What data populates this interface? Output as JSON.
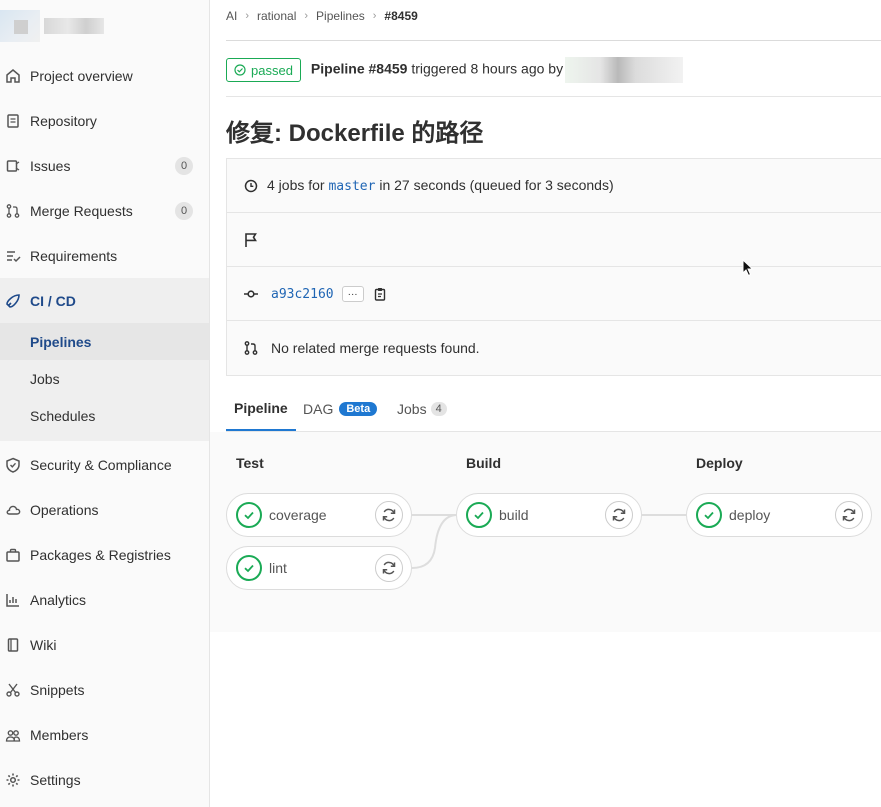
{
  "sidebar": {
    "items": [
      {
        "label": "Project overview"
      },
      {
        "label": "Repository"
      },
      {
        "label": "Issues",
        "count": "0"
      },
      {
        "label": "Merge Requests",
        "count": "0"
      },
      {
        "label": "Requirements"
      },
      {
        "label": "CI / CD"
      },
      {
        "label": "Security & Compliance"
      },
      {
        "label": "Operations"
      },
      {
        "label": "Packages & Registries"
      },
      {
        "label": "Analytics"
      },
      {
        "label": "Wiki"
      },
      {
        "label": "Snippets"
      },
      {
        "label": "Members"
      },
      {
        "label": "Settings"
      }
    ],
    "cicd_sub": [
      {
        "label": "Pipelines"
      },
      {
        "label": "Jobs"
      },
      {
        "label": "Schedules"
      }
    ]
  },
  "breadcrumb": [
    "AI",
    "rational",
    "Pipelines",
    "#8459"
  ],
  "pipeline": {
    "status": "passed",
    "title_bold": "Pipeline #8459",
    "title_rest": " triggered 8 hours ago by"
  },
  "commit_title": "修复: Dockerfile 的路径",
  "info": {
    "jobs_prefix": "4 jobs for ",
    "branch": "master",
    "jobs_suffix": " in 27 seconds (queued for 3 seconds)",
    "commit_sha": "a93c2160",
    "ellipsis": "···",
    "merge_requests": "No related merge requests found."
  },
  "tabs": {
    "pipeline": "Pipeline",
    "dag": "DAG",
    "dag_badge": "Beta",
    "jobs": "Jobs",
    "jobs_count": "4"
  },
  "stages": [
    {
      "name": "Test",
      "jobs": [
        "coverage",
        "lint"
      ]
    },
    {
      "name": "Build",
      "jobs": [
        "build"
      ]
    },
    {
      "name": "Deploy",
      "jobs": [
        "deploy"
      ]
    }
  ],
  "colors": {
    "success": "#1aaa55",
    "link": "#1f65b4",
    "accent": "#1f78d1"
  }
}
